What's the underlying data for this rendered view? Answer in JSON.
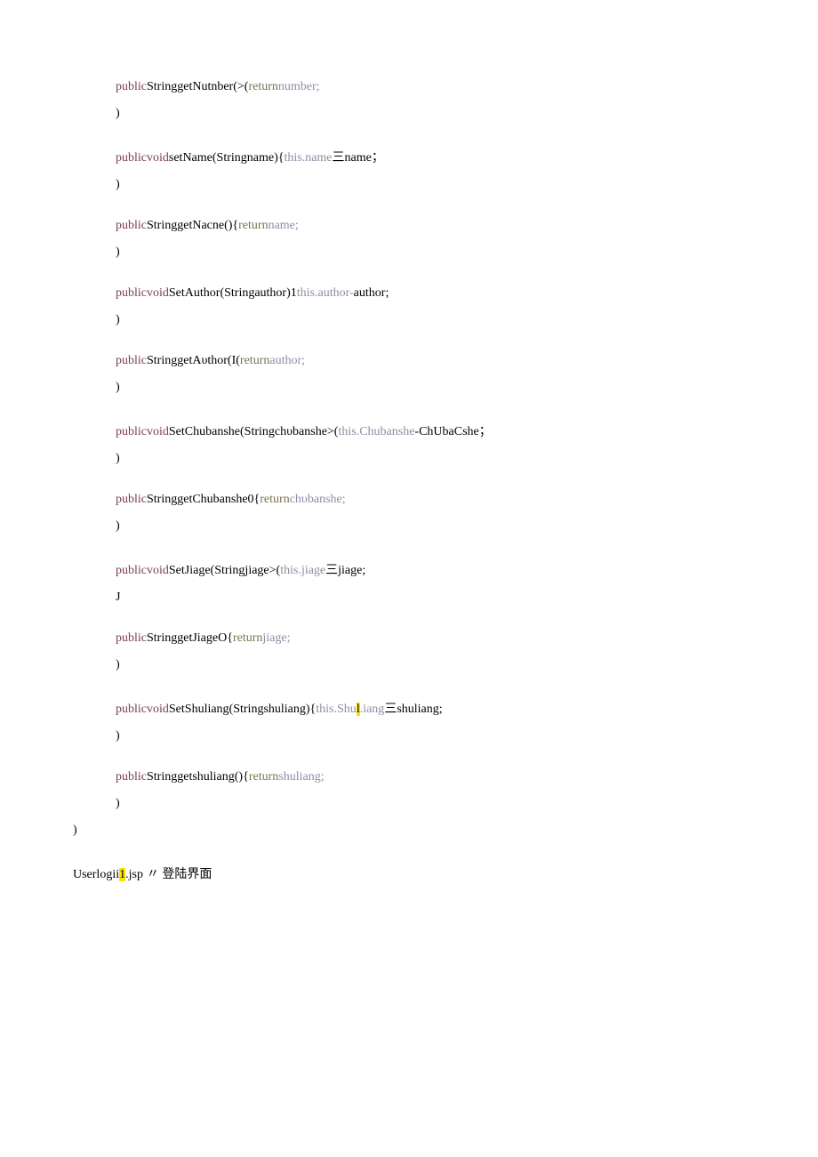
{
  "lines": [
    {
      "role": "code",
      "indent": 2,
      "parts": [
        {
          "t": "public",
          "c": "kw"
        },
        {
          "t": "StringgetNutnber(>(",
          "c": ""
        },
        {
          "t": "return",
          "c": "ret"
        },
        {
          "t": "number;",
          "c": "ident"
        }
      ]
    },
    {
      "role": "code",
      "indent": 2,
      "parts": [
        {
          "t": ")",
          "c": ""
        }
      ]
    },
    {
      "role": "blank"
    },
    {
      "role": "code",
      "indent": 2,
      "parts": [
        {
          "t": "public",
          "c": "kw"
        },
        {
          "t": "void",
          "c": "kw"
        },
        {
          "t": "setName(Stringname){",
          "c": ""
        },
        {
          "t": "this",
          "c": "this"
        },
        {
          "t": ".",
          "c": "this"
        },
        {
          "t": "name",
          "c": "ident"
        },
        {
          "t": "三name；",
          "c": ""
        }
      ]
    },
    {
      "role": "code",
      "indent": 2,
      "parts": [
        {
          "t": ")",
          "c": ""
        }
      ]
    },
    {
      "role": "blank"
    },
    {
      "role": "code",
      "indent": 2,
      "parts": [
        {
          "t": "public",
          "c": "kw"
        },
        {
          "t": "StringgetNacne(){",
          "c": ""
        },
        {
          "t": "return",
          "c": "ret"
        },
        {
          "t": "name;",
          "c": "ident"
        }
      ]
    },
    {
      "role": "code",
      "indent": 2,
      "parts": [
        {
          "t": ")",
          "c": ""
        }
      ]
    },
    {
      "role": "blank"
    },
    {
      "role": "code",
      "indent": 2,
      "parts": [
        {
          "t": "public",
          "c": "kw"
        },
        {
          "t": "void",
          "c": "kw"
        },
        {
          "t": "SetAuthor(Stringauthor)1",
          "c": ""
        },
        {
          "t": "this",
          "c": "this"
        },
        {
          "t": ".",
          "c": "this"
        },
        {
          "t": "author",
          "c": "ident"
        },
        {
          "t": "-",
          "c": "ident"
        },
        {
          "t": "author;",
          "c": ""
        }
      ]
    },
    {
      "role": "code",
      "indent": 2,
      "parts": [
        {
          "t": ")",
          "c": ""
        }
      ]
    },
    {
      "role": "blank"
    },
    {
      "role": "code",
      "indent": 2,
      "parts": [
        {
          "t": "public",
          "c": "kw"
        },
        {
          "t": "StringgetAυthor(I(",
          "c": ""
        },
        {
          "t": "return",
          "c": "ret"
        },
        {
          "t": "author;",
          "c": "ident"
        }
      ]
    },
    {
      "role": "code",
      "indent": 2,
      "parts": [
        {
          "t": ")",
          "c": ""
        }
      ]
    },
    {
      "role": "blank"
    },
    {
      "role": "code",
      "indent": 2,
      "parts": [
        {
          "t": "public",
          "c": "kw"
        },
        {
          "t": "void",
          "c": "kw"
        },
        {
          "t": "SetChubanshe(Stringchυbanshe>(",
          "c": ""
        },
        {
          "t": "this",
          "c": "this"
        },
        {
          "t": ".",
          "c": "this"
        },
        {
          "t": "Chubanshe",
          "c": "ident"
        },
        {
          "t": "-",
          "c": ""
        },
        {
          "t": "ChUbaCshe；",
          "c": ""
        }
      ]
    },
    {
      "role": "code",
      "indent": 2,
      "parts": [
        {
          "t": ")",
          "c": ""
        }
      ]
    },
    {
      "role": "blank"
    },
    {
      "role": "code",
      "indent": 2,
      "parts": [
        {
          "t": "public",
          "c": "kw"
        },
        {
          "t": "StringgetChubanshe0{",
          "c": ""
        },
        {
          "t": "return",
          "c": "ret"
        },
        {
          "t": "chυbanshe;",
          "c": "ident"
        }
      ]
    },
    {
      "role": "code",
      "indent": 2,
      "parts": [
        {
          "t": ")",
          "c": ""
        }
      ]
    },
    {
      "role": "blank"
    },
    {
      "role": "code",
      "indent": 2,
      "parts": [
        {
          "t": "public",
          "c": "kw"
        },
        {
          "t": "void",
          "c": "kw"
        },
        {
          "t": "SetJiage(Stringjiage>(",
          "c": ""
        },
        {
          "t": "this",
          "c": "this"
        },
        {
          "t": ".",
          "c": "this"
        },
        {
          "t": "jiage",
          "c": "ident"
        },
        {
          "t": "三",
          "c": ""
        },
        {
          "t": "jiage;",
          "c": ""
        }
      ]
    },
    {
      "role": "code",
      "indent": 2,
      "parts": [
        {
          "t": "J",
          "c": ""
        }
      ]
    },
    {
      "role": "blank"
    },
    {
      "role": "code",
      "indent": 2,
      "parts": [
        {
          "t": "public",
          "c": "kw"
        },
        {
          "t": "StringgetJiageO{",
          "c": ""
        },
        {
          "t": "return",
          "c": "ret"
        },
        {
          "t": "jiage;",
          "c": "ident"
        }
      ]
    },
    {
      "role": "code",
      "indent": 2,
      "parts": [
        {
          "t": ")",
          "c": ""
        }
      ]
    },
    {
      "role": "blank"
    },
    {
      "role": "code",
      "indent": 2,
      "parts": [
        {
          "t": "public",
          "c": "kw"
        },
        {
          "t": "void",
          "c": "kw"
        },
        {
          "t": "SetShuliang(Stringshuliang){",
          "c": ""
        },
        {
          "t": "this",
          "c": "this"
        },
        {
          "t": ".",
          "c": "this"
        },
        {
          "t": "Shu",
          "c": "ident"
        },
        {
          "t": "l",
          "c": "hl"
        },
        {
          "t": ".iang",
          "c": "ident"
        },
        {
          "t": "三",
          "c": ""
        },
        {
          "t": "shuliang;",
          "c": ""
        }
      ]
    },
    {
      "role": "code",
      "indent": 2,
      "parts": [
        {
          "t": ")",
          "c": ""
        }
      ]
    },
    {
      "role": "blank"
    },
    {
      "role": "code",
      "indent": 2,
      "parts": [
        {
          "t": "public",
          "c": "kw"
        },
        {
          "t": "Stringgetshuliang(){",
          "c": ""
        },
        {
          "t": "return",
          "c": "ret"
        },
        {
          "t": "shuliang;",
          "c": "ident"
        }
      ]
    },
    {
      "role": "code",
      "indent": 2,
      "parts": [
        {
          "t": ")",
          "c": ""
        }
      ]
    },
    {
      "role": "code",
      "indent": 1,
      "parts": [
        {
          "t": ")",
          "c": ""
        }
      ]
    },
    {
      "role": "blank"
    },
    {
      "role": "code",
      "indent": 1,
      "parts": [
        {
          "t": "Userlogii",
          "c": ""
        },
        {
          "t": "1",
          "c": "hl"
        },
        {
          "t": ".jsp",
          "c": ""
        },
        {
          "t": " 〃",
          "c": "hash"
        },
        {
          "t": " 登陆界面",
          "c": ""
        }
      ]
    }
  ]
}
